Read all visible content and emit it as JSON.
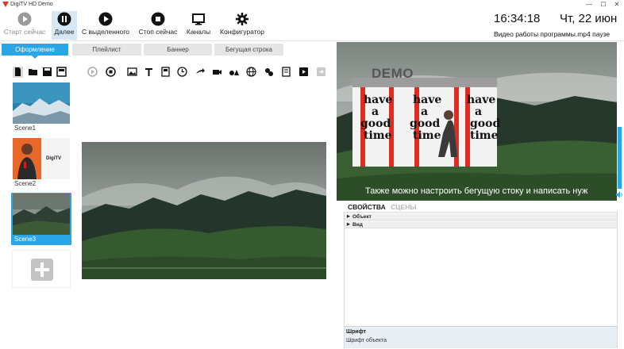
{
  "window": {
    "title": "DigiTV HD Demo",
    "controls": [
      "—",
      "☐",
      "✕"
    ]
  },
  "toolbar": {
    "buttons": [
      {
        "label": "Старт сейчас",
        "icon": "play-icon",
        "state": "disabled"
      },
      {
        "label": "Далее",
        "icon": "pause-icon",
        "state": "active"
      },
      {
        "label": "С выделенного",
        "icon": "play-from-selected-icon",
        "state": "normal"
      },
      {
        "label": "Стоп сейчас",
        "icon": "stop-icon",
        "state": "normal"
      },
      {
        "label": "Каналы",
        "icon": "monitor-icon",
        "state": "normal"
      },
      {
        "label": "Конфигуратор",
        "icon": "gear-icon",
        "state": "normal"
      }
    ]
  },
  "status": {
    "time": "16:34:18",
    "date": "Чт, 22 июн",
    "text": "Видео работы программы.mp4 паузе"
  },
  "tabs": [
    {
      "label": "Оформление",
      "active": true
    },
    {
      "label": "Плейлист",
      "active": false
    },
    {
      "label": "Баннер",
      "active": false
    },
    {
      "label": "Бегущая строка",
      "active": false
    }
  ],
  "edit_tools": [
    "new-file-icon",
    "open-folder-icon",
    "save-icon",
    "save-as-icon",
    "play-preview-icon",
    "stop-preview-icon",
    "image-icon",
    "text-icon",
    "note-icon",
    "clock-icon",
    "arrow-icon",
    "camera-icon",
    "shapes-icon",
    "globe-icon",
    "weather-icon",
    "document-icon",
    "video-icon",
    "export-icon"
  ],
  "scenes": [
    {
      "name": "Scene1",
      "selected": false
    },
    {
      "name": "Scene2",
      "selected": false,
      "logo": "DigiTV"
    },
    {
      "name": "Scene3",
      "selected": true
    }
  ],
  "preview": {
    "ticker_text": "Также можно настроить бегущую стоку и написать нуж",
    "banner_words": [
      "have",
      "a",
      "good",
      "time"
    ],
    "banner_label": "DEMO"
  },
  "properties": {
    "tabs": [
      {
        "label": "СВОЙСТВА",
        "active": true
      },
      {
        "label": "СЦЕНЫ",
        "active": false
      }
    ],
    "rows": [
      "Объект",
      "Вид"
    ],
    "footer_title": "Шрифт",
    "footer_desc": "Шрифт объекта"
  },
  "colors": {
    "accent": "#2aa6e6",
    "active_button": "#d6e8f6",
    "tab_inactive": "#e6e6e6"
  },
  "volume_level": 1.0
}
